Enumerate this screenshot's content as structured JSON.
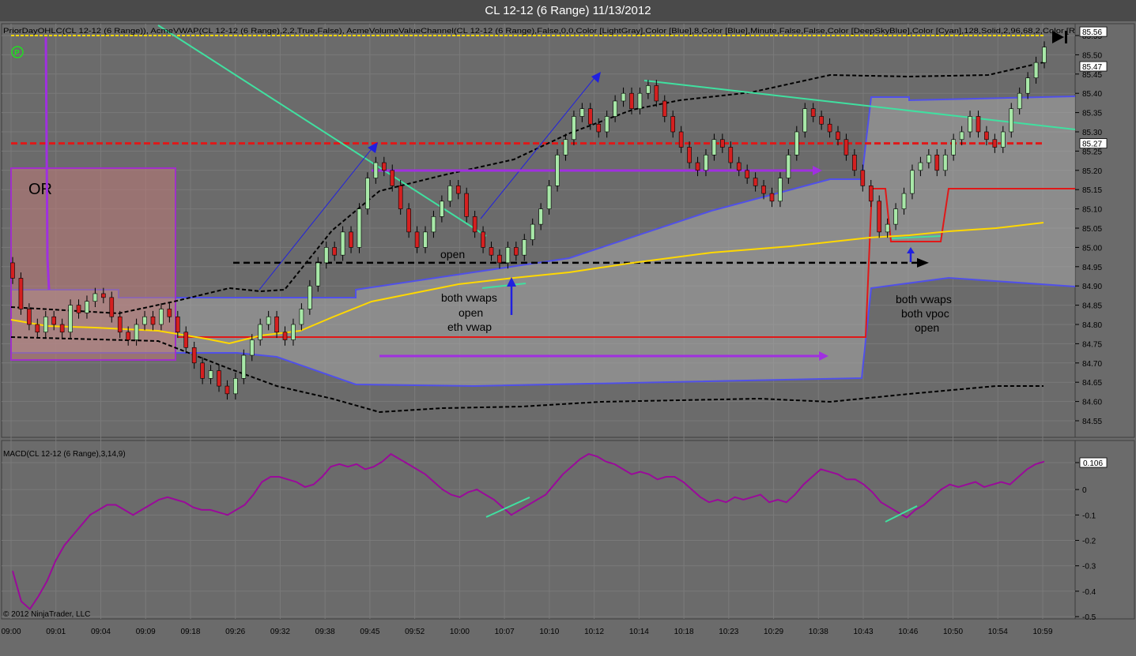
{
  "window": {
    "title": "CL 12-12 (6 Range)  11/13/2012"
  },
  "indicator_labels": {
    "main": "PriorDayOHLC(CL 12-12 (6 Range)), AcmeVWAP(CL 12-12 (6 Range),2,2,True,False), AcmeVolumeValueChannel(CL 12-12 (6 Range),False,0,0,Color [LightGray],Color [Blue],8,Color [Blue],Minute,False,False,Color [DeepSkyBlue],Color [Cyan],128,Solid,2,96,68,2,Color [R",
    "macd": "MACD(CL 12-12 (6 Range),3,14,9)"
  },
  "copyright": "© 2012 NinjaTrader, LLC",
  "colors": {
    "background": "#6b6b6b",
    "candle_up": "#a8e8a8",
    "candle_down": "#d42020",
    "vwap": "#ffd800",
    "channel": "#5050e8",
    "prior_close": "#e01818",
    "macd": "#9a0a9a",
    "trend": "#40e0a0",
    "arrow": "#2020e0"
  },
  "annotations": {
    "or": "OR",
    "open_1": "open",
    "group_1": [
      "both vwaps",
      "open",
      "eth vwap"
    ],
    "group_2": [
      "both vwaps",
      "both vpoc",
      "open"
    ]
  },
  "chart_data": [
    {
      "type": "candlestick",
      "title": "CL 12-12 (6 Range)  11/13/2012",
      "price_axis": {
        "ticks": [
          "85.55",
          "85.50",
          "85.45",
          "85.40",
          "85.35",
          "85.30",
          "85.25",
          "85.20",
          "85.15",
          "85.10",
          "85.05",
          "85.00",
          "84.95",
          "84.90",
          "84.85",
          "84.80",
          "84.75",
          "84.70",
          "84.65",
          "84.60",
          "84.55"
        ],
        "ylim": [
          84.51,
          85.6
        ],
        "badges": [
          {
            "label": "85.56",
            "value": 85.56
          },
          {
            "label": "85.47",
            "value": 85.47
          },
          {
            "label": "85.27",
            "value": 85.27
          }
        ]
      },
      "time_axis": [
        "09:00",
        "09:01",
        "09:04",
        "09:09",
        "09:18",
        "09:26",
        "09:32",
        "09:38",
        "09:45",
        "09:52",
        "10:00",
        "10:07",
        "10:10",
        "10:12",
        "10:14",
        "10:18",
        "10:23",
        "10:29",
        "10:38",
        "10:43",
        "10:46",
        "10:50",
        "10:54",
        "10:59"
      ],
      "closes": [
        84.92,
        84.84,
        84.8,
        84.78,
        84.82,
        84.8,
        84.78,
        84.85,
        84.83,
        84.86,
        84.88,
        84.87,
        84.82,
        84.78,
        84.76,
        84.8,
        84.82,
        84.8,
        84.84,
        84.82,
        84.78,
        84.74,
        84.7,
        84.66,
        84.68,
        84.64,
        84.62,
        84.66,
        84.72,
        84.76,
        84.8,
        84.82,
        84.78,
        84.76,
        84.8,
        84.84,
        84.9,
        84.96,
        85.0,
        84.98,
        85.04,
        85.0,
        85.1,
        85.18,
        85.22,
        85.2,
        85.16,
        85.1,
        85.04,
        85.0,
        85.04,
        85.08,
        85.12,
        85.16,
        85.14,
        85.08,
        85.04,
        85.0,
        84.98,
        84.96,
        85.0,
        84.98,
        85.02,
        85.06,
        85.1,
        85.16,
        85.24,
        85.28,
        85.34,
        85.36,
        85.32,
        85.3,
        85.34,
        85.38,
        85.4,
        85.36,
        85.4,
        85.42,
        85.38,
        85.34,
        85.3,
        85.26,
        85.22,
        85.2,
        85.24,
        85.28,
        85.26,
        85.22,
        85.2,
        85.18,
        85.16,
        85.14,
        85.12,
        85.18,
        85.24,
        85.3,
        85.36,
        85.34,
        85.32,
        85.3,
        85.28,
        85.24,
        85.2,
        85.16,
        85.12,
        85.04,
        85.06,
        85.1,
        85.14,
        85.2,
        85.22,
        85.24,
        85.2,
        85.24,
        85.28,
        85.3,
        85.34,
        85.3,
        85.28,
        85.26,
        85.3,
        85.36,
        85.4,
        85.44,
        85.48,
        85.52
      ]
    },
    {
      "type": "line",
      "title": "MACD(CL 12-12 (6 Range),3,14,9)",
      "axis_ticks": [
        "0.106",
        "0",
        "-0.1",
        "-0.2",
        "-0.3",
        "-0.4",
        "-0.5"
      ],
      "ylim": [
        -0.5,
        0.2
      ],
      "badge": {
        "label": "0.106",
        "value": 0.106
      },
      "values": [
        -0.32,
        -0.44,
        -0.47,
        -0.42,
        -0.36,
        -0.28,
        -0.22,
        -0.18,
        -0.14,
        -0.1,
        -0.08,
        -0.06,
        -0.06,
        -0.08,
        -0.1,
        -0.08,
        -0.06,
        -0.04,
        -0.03,
        -0.04,
        -0.05,
        -0.07,
        -0.08,
        -0.08,
        -0.09,
        -0.1,
        -0.08,
        -0.06,
        -0.02,
        0.03,
        0.05,
        0.05,
        0.04,
        0.03,
        0.01,
        0.02,
        0.05,
        0.09,
        0.1,
        0.09,
        0.1,
        0.08,
        0.09,
        0.11,
        0.14,
        0.12,
        0.1,
        0.08,
        0.06,
        0.03,
        0.0,
        -0.02,
        -0.03,
        -0.01,
        0.0,
        -0.02,
        -0.04,
        -0.07,
        -0.1,
        -0.08,
        -0.06,
        -0.04,
        -0.02,
        0.02,
        0.06,
        0.09,
        0.12,
        0.14,
        0.13,
        0.11,
        0.1,
        0.08,
        0.06,
        0.07,
        0.06,
        0.04,
        0.05,
        0.05,
        0.03,
        0.0,
        -0.03,
        -0.05,
        -0.04,
        -0.05,
        -0.03,
        -0.04,
        -0.03,
        -0.02,
        -0.05,
        -0.04,
        -0.05,
        -0.02,
        0.02,
        0.05,
        0.08,
        0.07,
        0.06,
        0.04,
        0.04,
        0.02,
        -0.01,
        -0.05,
        -0.07,
        -0.09,
        -0.11,
        -0.08,
        -0.06,
        -0.03,
        0.0,
        0.02,
        0.01,
        0.02,
        0.03,
        0.01,
        0.02,
        0.03,
        0.02,
        0.05,
        0.08,
        0.1,
        0.11
      ]
    }
  ]
}
